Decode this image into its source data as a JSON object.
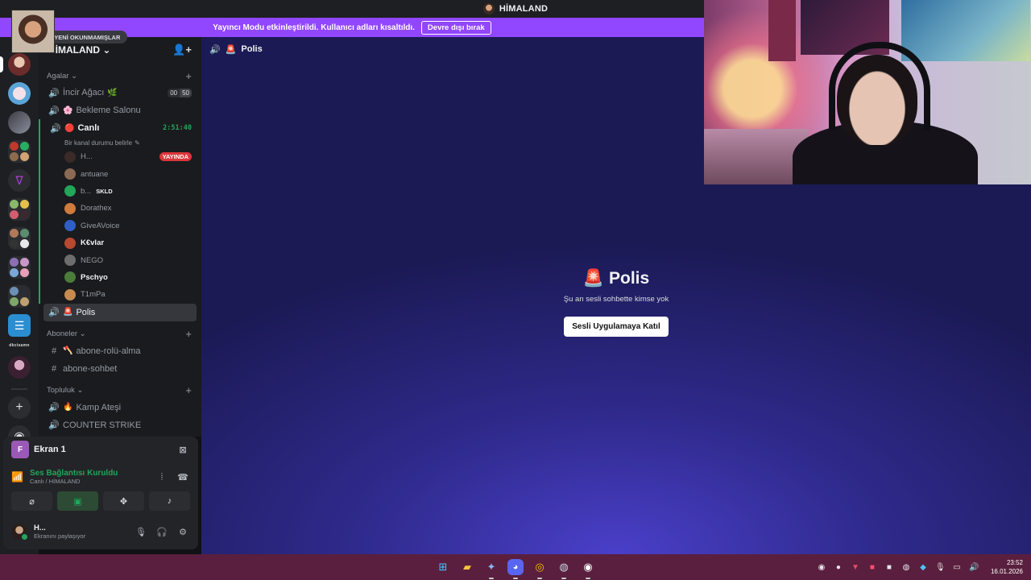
{
  "window": {
    "title": "HİMALAND"
  },
  "banner": {
    "message": "Yayıncı Modu etkinleştirildi. Kullanıcı adları kısaltıldı.",
    "disable_label": "Devre dışı bırak"
  },
  "server": {
    "name": "HİMALAND",
    "new_unread_label": "YENİ OKUNMAMIŞLAR"
  },
  "categories": {
    "agalar": "Agalar",
    "aboneler": "Aboneler",
    "topluluk": "Topluluk"
  },
  "channels": {
    "incir": {
      "name": "İncir Ağacı",
      "count_a": "00",
      "count_b": "50"
    },
    "bekleme": {
      "name": "Bekleme Salonu"
    },
    "canli": {
      "name": "Canlı",
      "timer": "2:51:40",
      "status": "Bir kanal durumu belirle"
    },
    "polis": {
      "name": "Polis"
    },
    "abone_rolu": {
      "name": "abone-rolü-alma"
    },
    "abone_sohbet": {
      "name": "abone-sohbet"
    },
    "kamp": {
      "name": "Kamp Ateşi"
    },
    "counter": {
      "name": "COUNTER STRIKE"
    }
  },
  "voice_users": [
    {
      "name": "H...",
      "badge": "YAYINDA",
      "bright": false,
      "color": "#3a2a28"
    },
    {
      "name": "antuane",
      "badge": "",
      "bright": false,
      "color": "#8a6a52"
    },
    {
      "name": "b...",
      "badge": "",
      "tag": "SKLD",
      "bright": false,
      "color": "#23a55a"
    },
    {
      "name": "Dorathex",
      "badge": "",
      "bright": false,
      "color": "#d07a3b"
    },
    {
      "name": "GiveAVoice",
      "badge": "",
      "bright": false,
      "color": "#2f5fc4"
    },
    {
      "name": "K€vlar",
      "badge": "",
      "bright": true,
      "color": "#b8482f"
    },
    {
      "name": "NEGO",
      "badge": "",
      "bright": false,
      "color": "#6d6d6d"
    },
    {
      "name": "Pschyo",
      "badge": "",
      "bright": true,
      "color": "#4a7d3a"
    },
    {
      "name": "T1mPa",
      "badge": "",
      "bright": false,
      "color": "#c78a4f"
    }
  ],
  "panel": {
    "screen_label": "Ekran 1",
    "screen_initial": "F",
    "connection_title": "Ses Bağlantısı Kuruldu",
    "connection_sub": "Canlı / HİMALAND",
    "user_name": "H...",
    "user_status": "Ekranını paylaşıyor"
  },
  "main": {
    "header_channel": "Polis",
    "title": "Polis",
    "empty_text": "Şu an sesli sohbette kimse yok",
    "join_label": "Sesli Uygulamaya Katıl"
  },
  "taskbar": {
    "time": "23:52",
    "date": "16.01.2026"
  },
  "colors": {
    "accent": "#9146ff",
    "online": "#23a55a",
    "live": "#da373c"
  }
}
